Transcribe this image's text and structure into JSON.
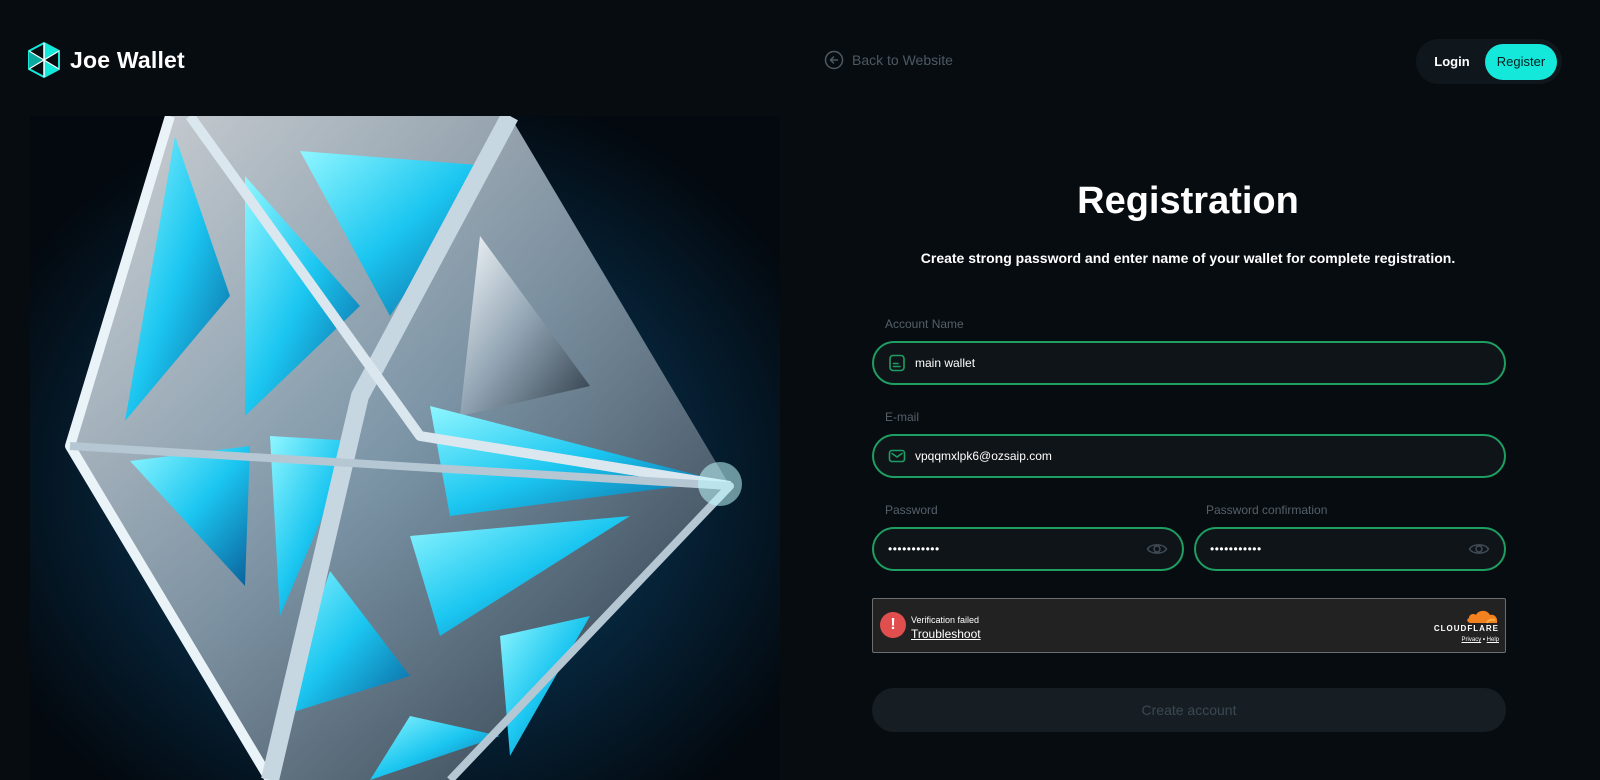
{
  "brand": {
    "name": "Joe Wallet",
    "icon": "joe-wallet-logo-icon"
  },
  "nav": {
    "back_label": "Back to Website",
    "back_icon": "arrow-left-circle-icon",
    "login_label": "Login",
    "register_label": "Register"
  },
  "form": {
    "title": "Registration",
    "subtitle": "Create strong password and enter name of your wallet for complete registration.",
    "account_name": {
      "label": "Account Name",
      "value": "main wallet",
      "icon": "document-icon"
    },
    "email": {
      "label": "E-mail",
      "value": "vpqqmxlpk6@ozsaip.com",
      "icon": "envelope-icon"
    },
    "password": {
      "label": "Password",
      "value": "•••••••••••",
      "icon": "eye-icon"
    },
    "password_confirm": {
      "label": "Password confirmation",
      "value": "•••••••••••",
      "icon": "eye-icon"
    },
    "submit_label": "Create account"
  },
  "captcha": {
    "alert_symbol": "!",
    "status": "Verification failed",
    "action": "Troubleshoot",
    "brand": "CLOUDFLARE",
    "privacy": "Privacy",
    "separator": "•",
    "help": "Help"
  },
  "colors": {
    "background": "#070c10",
    "accent": "#14e8da",
    "field_border": "#1f9e63",
    "error": "#e04e4e",
    "cloudflare_orange": "#f48120"
  }
}
